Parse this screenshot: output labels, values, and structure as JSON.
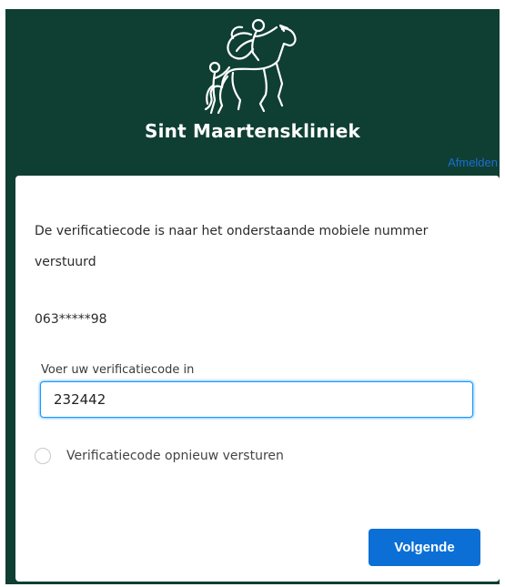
{
  "brand": {
    "name": "Sint Maartenskliniek",
    "logo_icon": "horseman-cloak-logo"
  },
  "header": {
    "user_text": "",
    "logout_label": "Afmelden"
  },
  "verification": {
    "description": "De verificatiecode is naar het onderstaande mobiele nummer verstuurd",
    "phone_masked": "063*****98",
    "code_label": "Voer uw verificatiecode in",
    "code_value": "232442",
    "resend_label": "Verificatiecode opnieuw versturen",
    "resend_checked": false,
    "next_label": "Volgende"
  },
  "colors": {
    "background": "#0f3e33",
    "button": "#0b6fd6",
    "link": "#1b6fd1",
    "input_focus": "#1b96ff"
  }
}
